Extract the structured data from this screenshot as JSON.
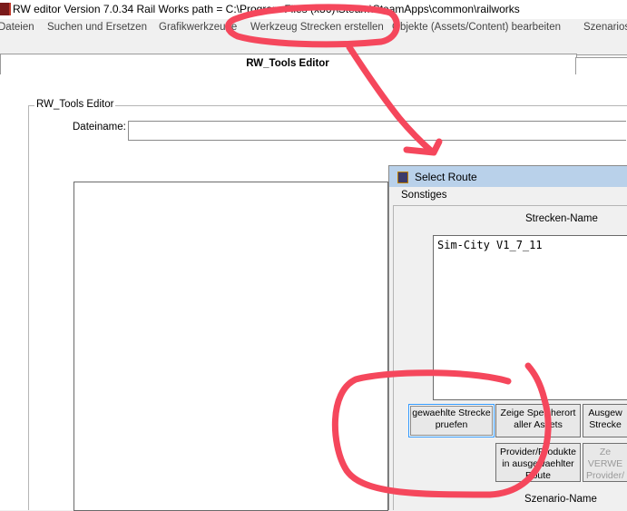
{
  "window": {
    "title": "RW editor  Version 7.0.34  Rail Works path = C:\\Program Files (x86)\\Steam\\SteamApps\\common\\railworks"
  },
  "menubar": {
    "items": [
      "Dateien",
      "Suchen und Ersetzen",
      "Grafikwerkzeuge",
      "Werkzeug Strecken erstellen",
      "Objekte (Assets/Content) bearbeiten",
      "Szenarios"
    ]
  },
  "main": {
    "tab_label": "RW_Tools Editor",
    "group_label": "RW_Tools Editor",
    "filename_label": "Dateiname:",
    "filename_value": ""
  },
  "dialog": {
    "title": "Select Route",
    "menu": "Sonstiges",
    "route_list_header": "Strecken-Name",
    "routes": [
      "Sim-City V1_7_11"
    ],
    "buttons": {
      "check_route": "gewaehlte Strecke pruefen",
      "show_location": "Zeige Speicherort aller Assets",
      "selected_route": "Ausgew Strecke",
      "providers": "Provider/Produkte in ausgewaehlter Route",
      "used": "Ze VERWE Provider/"
    },
    "scenario_header": "Szenario-Name"
  },
  "colors": {
    "annotation": "#f5475c",
    "dialog_title_bg": "#b9d1ea"
  }
}
